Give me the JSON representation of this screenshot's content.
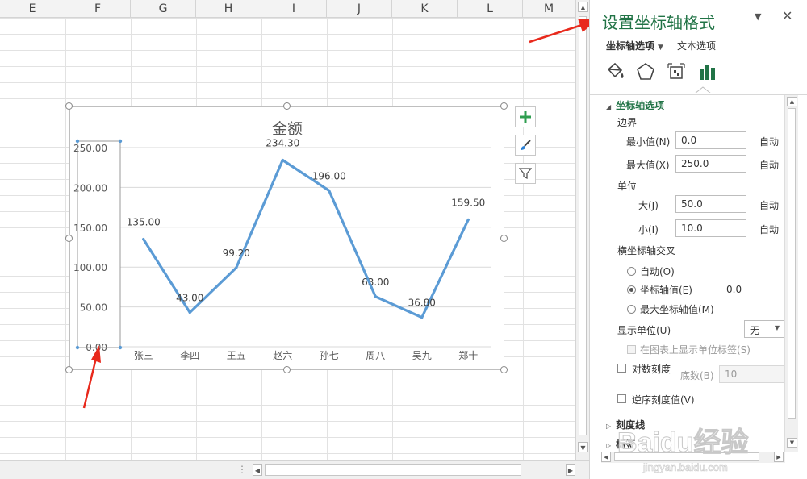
{
  "sheet": {
    "columns": [
      "E",
      "F",
      "G",
      "H",
      "I",
      "J",
      "K",
      "L",
      "M"
    ]
  },
  "chart_data": {
    "type": "line",
    "title": "金额",
    "categories": [
      "张三",
      "李四",
      "王五",
      "赵六",
      "孙七",
      "周八",
      "吴九",
      "郑十"
    ],
    "series": [
      {
        "values": [
          135.0,
          43.0,
          99.2,
          234.3,
          196.0,
          63.0,
          36.8,
          159.5
        ]
      }
    ],
    "data_labels": [
      "135.00",
      "43.00",
      "99.20",
      "234.30",
      "196.00",
      "63.00",
      "36.80",
      "159.50"
    ],
    "y_tick_labels": [
      "0.00",
      "50.00",
      "100.00",
      "150.00",
      "200.00",
      "250.00"
    ],
    "ylim": [
      0,
      250
    ],
    "y_major_unit": 50,
    "grid": true,
    "line_color": "#5b9bd5",
    "legend": "none"
  },
  "chart_buttons": {
    "add_element_icon": "plus-icon",
    "style_icon": "brush-icon",
    "filter_icon": "filter-icon"
  },
  "pane": {
    "title": "设置坐标轴格式",
    "tabs": [
      {
        "label": "坐标轴选项",
        "active": true
      },
      {
        "label": "文本选项",
        "active": false
      }
    ],
    "icons": [
      "fill-line-icon",
      "effects-pentagon-icon",
      "size-properties-icon",
      "axis-options-bar-icon"
    ],
    "accent": "#217346",
    "section_axis_options": "坐标轴选项",
    "bounds": {
      "heading": "边界",
      "min_label": "最小值(N)",
      "min_value": "0.0",
      "max_label": "最大值(X)",
      "max_value": "250.0",
      "auto": "自动"
    },
    "units": {
      "heading": "单位",
      "major_label": "大(J)",
      "major_value": "50.0",
      "minor_label": "小(I)",
      "minor_value": "10.0",
      "auto": "自动"
    },
    "crosses": {
      "heading": "横坐标轴交叉",
      "option_auto": "自动(O)",
      "option_value": "坐标轴值(E)",
      "option_value_input": "0.0",
      "option_max": "最大坐标轴值(M)",
      "selected": "坐标轴值(E)"
    },
    "display_units": {
      "label": "显示单位(U)",
      "value": "无",
      "show_label": "在图表上显示单位标签(S)"
    },
    "log_scale": {
      "label": "对数刻度",
      "base_label": "底数(B)",
      "base_value": "10"
    },
    "reverse_order": "逆序刻度值(V)",
    "collapsed_sections": [
      "刻度线",
      "标签"
    ]
  },
  "watermark": {
    "text": "Baidu经验",
    "url": "jingyan.baidu.com"
  }
}
